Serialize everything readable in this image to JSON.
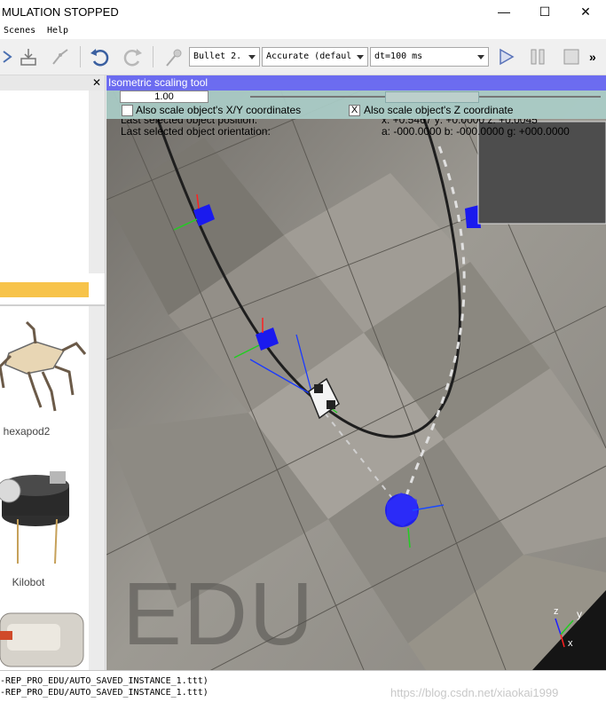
{
  "window": {
    "title": "MULATION STOPPED",
    "minimize_glyph": "—",
    "maximize_glyph": "☐",
    "close_glyph": "✕"
  },
  "menu": {
    "items": [
      "Scenes",
      "Help"
    ]
  },
  "toolbar": {
    "physics_engine": "Bullet 2.",
    "accuracy": "Accurate (defaul",
    "timestep": "dt=100 ms",
    "more_glyph": "»"
  },
  "left_panel": {
    "close_glyph": "✕",
    "models": [
      {
        "label": "hexapod2"
      },
      {
        "label": "Kilobot"
      }
    ]
  },
  "iso_tool": {
    "title": "Isometric scaling tool",
    "scale_value": "1.00",
    "chk_xy_label": "Also scale object's X/Y coordinates",
    "chk_xy_checked": false,
    "chk_z_label": "Also scale object's Z coordinate",
    "chk_z_checked": true,
    "chk_z_glyph": "X"
  },
  "overlay_info": {
    "position_label": "Last selected object position:",
    "position_values": "x: +0.5467   y: +0.0000   z: +0.0045",
    "orientation_label": "Last selected object orientation:",
    "orientation_values": "a: -000.0000   b: -000.0000   g: +000.0000"
  },
  "viewport": {
    "watermark": "EDU",
    "axis_labels": {
      "z": "z",
      "y": "y",
      "x": "x"
    }
  },
  "console": {
    "lines": [
      "-REP_PRO_EDU/AUTO_SAVED_INSTANCE_1.ttt)",
      "-REP_PRO_EDU/AUTO_SAVED_INSTANCE_1.ttt)"
    ]
  },
  "page_watermark": "https://blog.csdn.net/xiaokai1999",
  "colors": {
    "iso_header": "#6c6cf0",
    "iso_body": "#aacdc8",
    "floor": "#8e8b84",
    "selection_bar": "#f7c34a",
    "cube": "#1a1aee",
    "path": "#1e1e1e"
  }
}
